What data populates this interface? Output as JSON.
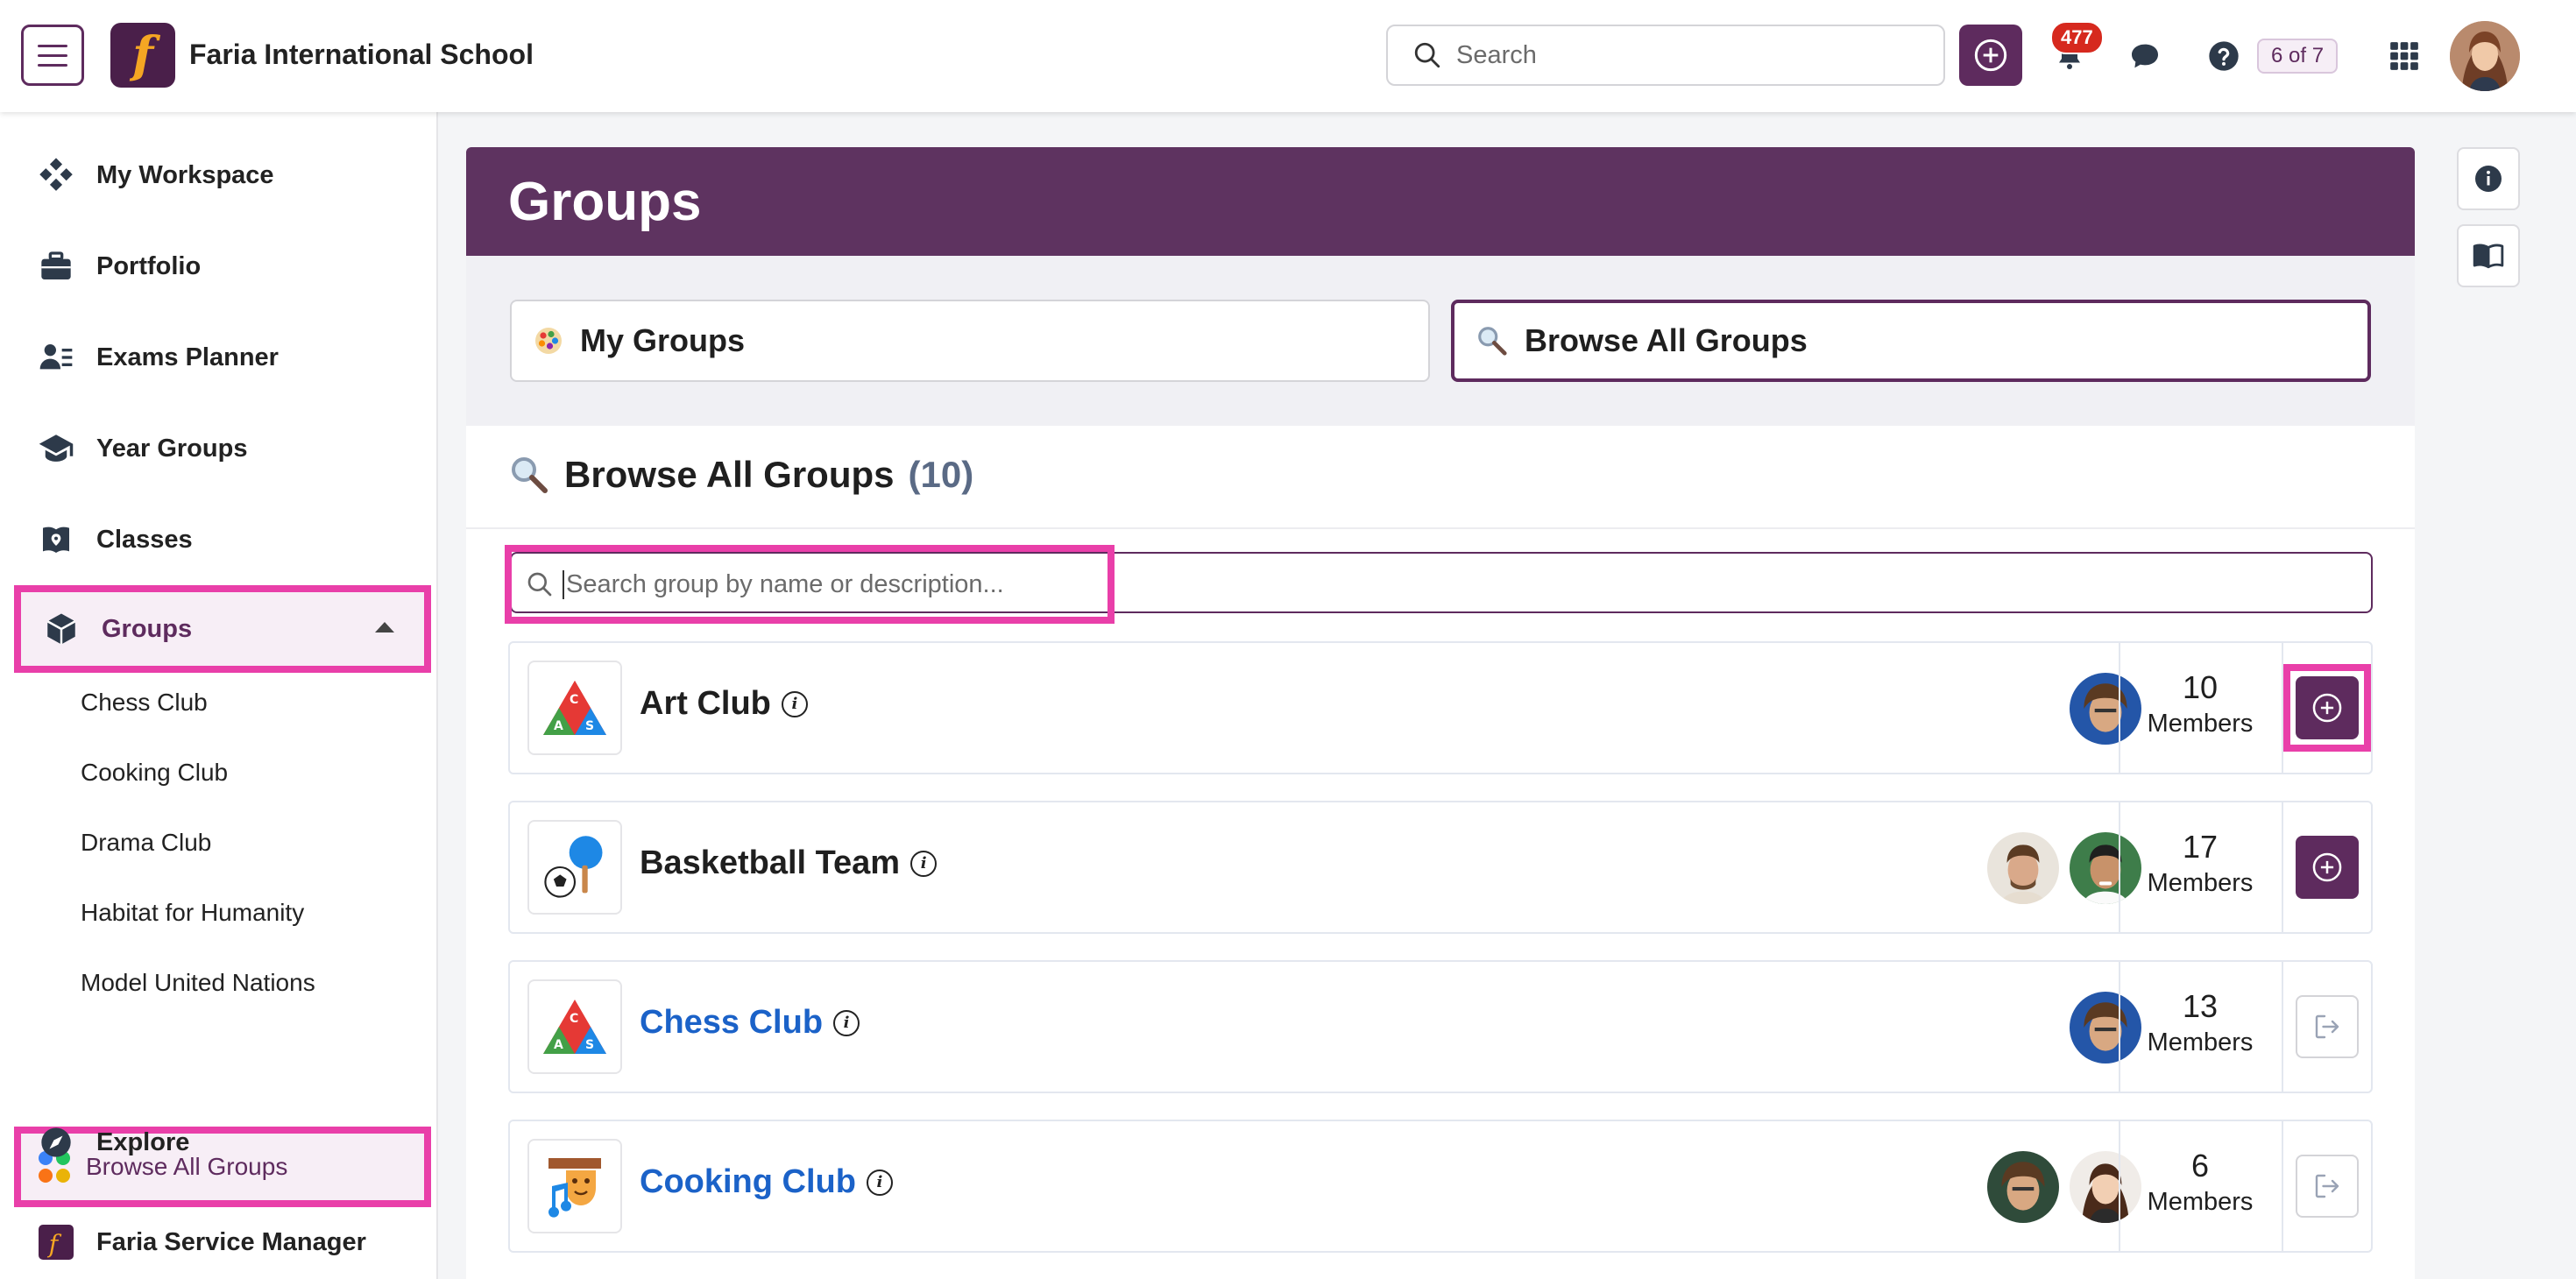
{
  "app": {
    "school_name": "Faria International School",
    "logo_letter": "f"
  },
  "topbar": {
    "search_placeholder": "Search",
    "notification_count": "477",
    "pager": "6 of 7"
  },
  "sidebar": {
    "items": [
      {
        "label": "My Workspace",
        "icon": "workspace-icon"
      },
      {
        "label": "Portfolio",
        "icon": "briefcase-icon"
      },
      {
        "label": "Exams Planner",
        "icon": "exams-icon"
      },
      {
        "label": "Year Groups",
        "icon": "graduation-cap-icon"
      },
      {
        "label": "Classes",
        "icon": "classes-icon"
      },
      {
        "label": "Groups",
        "icon": "cube-icon",
        "expanded": true
      },
      {
        "label": "Explore",
        "icon": "compass-icon"
      },
      {
        "label": "Faria Service Manager",
        "icon": "faria-icon"
      }
    ],
    "subitems": [
      "Chess Club",
      "Cooking Club",
      "Drama Club",
      "Habitat for Humanity",
      "Model United Nations"
    ],
    "browse_label": "Browse All Groups"
  },
  "page": {
    "title": "Groups",
    "tabs": [
      {
        "label": "My Groups"
      },
      {
        "label": "Browse All Groups",
        "selected": true
      }
    ],
    "panel_title": "Browse All Groups",
    "panel_count": "(10)",
    "group_search_placeholder": "Search group by name or description..."
  },
  "groups": [
    {
      "name": "Art Club",
      "members": "10",
      "members_label": "Members",
      "action": "join",
      "linked": false
    },
    {
      "name": "Basketball Team",
      "members": "17",
      "members_label": "Members",
      "action": "join",
      "linked": false
    },
    {
      "name": "Chess Club",
      "members": "13",
      "members_label": "Members",
      "action": "leave",
      "linked": true
    },
    {
      "name": "Cooking Club",
      "members": "6",
      "members_label": "Members",
      "action": "leave",
      "linked": true
    }
  ],
  "colors": {
    "brand": "#5e2b5e",
    "header": "#5e3360",
    "highlight": "#e93fa9",
    "link": "#1b62c8",
    "badge": "#d6291e"
  }
}
